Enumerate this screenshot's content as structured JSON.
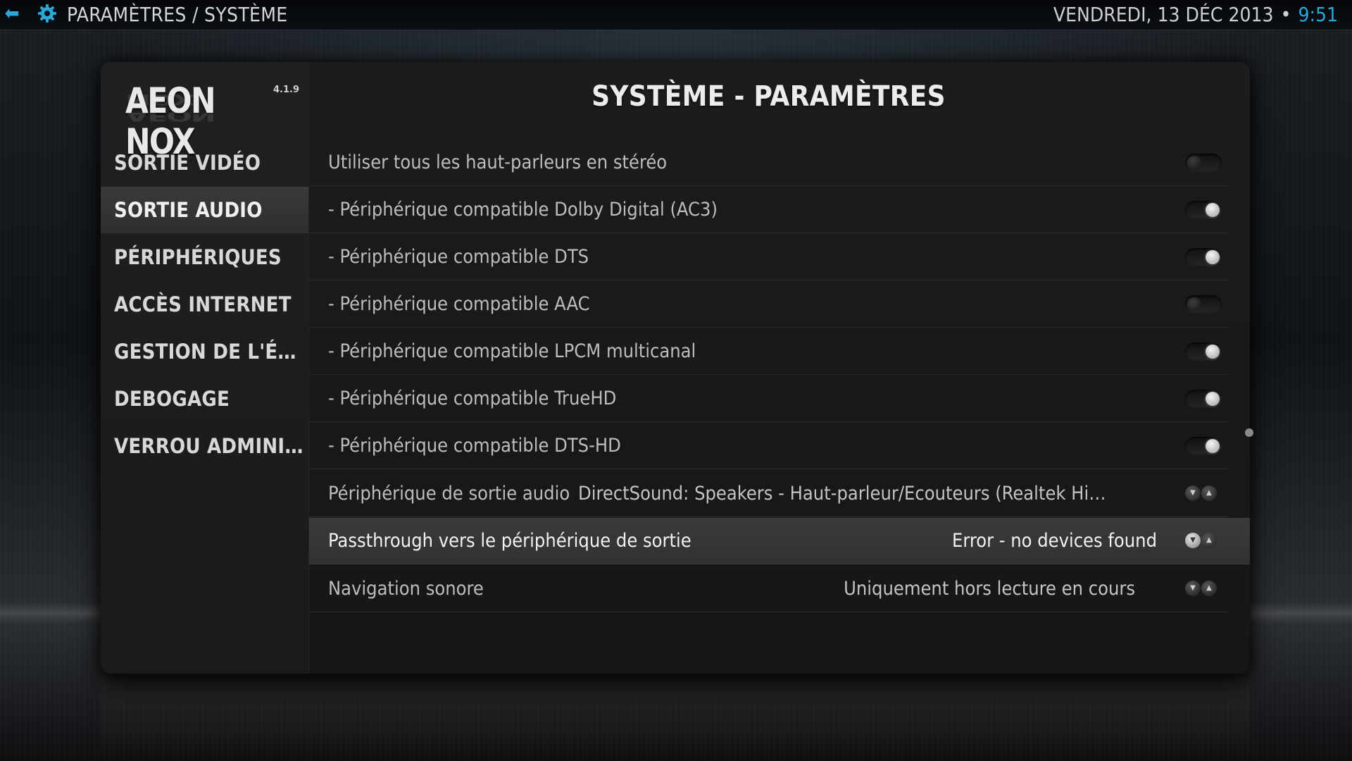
{
  "header": {
    "back_icon": "back-arrow-icon",
    "settings_icon": "gear-icon",
    "breadcrumb": "PARAMÈTRES / SYSTÈME",
    "date": "VENDREDI, 13 DÉC 2013",
    "separator": "•",
    "time": "9:51",
    "accent_color": "#2aa7d8"
  },
  "logo": {
    "text": "AEON NOX",
    "version": "4.1.9"
  },
  "sidebar": {
    "items": [
      {
        "label": "SORTIE VIDÉO",
        "active": false
      },
      {
        "label": "SORTIE AUDIO",
        "active": true
      },
      {
        "label": "PÉRIPHÉRIQUES",
        "active": false
      },
      {
        "label": "ACCÈS INTERNET",
        "active": false
      },
      {
        "label": "GESTION DE L'ÉNE...",
        "active": false
      },
      {
        "label": "DEBOGAGE",
        "active": false
      },
      {
        "label": "VERROU ADMINIS...",
        "active": false
      }
    ]
  },
  "main": {
    "title": "SYSTÈME - PARAMÈTRES",
    "settings": [
      {
        "label": "Utiliser tous les haut-parleurs en stéréo",
        "type": "toggle",
        "on": false
      },
      {
        "label": "- Périphérique compatible Dolby Digital (AC3)",
        "type": "toggle",
        "on": true
      },
      {
        "label": "- Périphérique compatible DTS",
        "type": "toggle",
        "on": true
      },
      {
        "label": "- Périphérique compatible AAC",
        "type": "toggle",
        "on": false
      },
      {
        "label": "- Périphérique compatible LPCM multicanal",
        "type": "toggle",
        "on": true
      },
      {
        "label": "- Périphérique compatible TrueHD",
        "type": "toggle",
        "on": true
      },
      {
        "label": "- Périphérique compatible DTS-HD",
        "type": "toggle",
        "on": true
      },
      {
        "label": "Périphérique de sortie audio",
        "type": "spinner",
        "value": "DirectSound: Speakers - Haut-parleur/Ecouteurs (Realtek High..."
      },
      {
        "label": "Passthrough vers le périphérique de sortie",
        "type": "spinner",
        "value": "Error - no devices found",
        "focused": true
      },
      {
        "label": "Navigation sonore",
        "type": "spinner",
        "value": "Uniquement hors lecture en cours"
      }
    ]
  }
}
